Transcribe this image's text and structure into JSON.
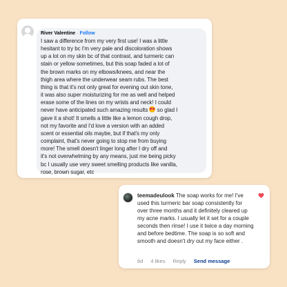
{
  "comment1": {
    "author": "River Valentine",
    "separator": "·",
    "follow_label": "Follow",
    "lines": [
      "I saw a difference from my very first use! I was a little",
      "hesitant to try bc I'm very pale and discoloration shows",
      "up a lot on my skin bc of that contrast, and turmeric can",
      "stain or yellow sometimes, but this soap faded a lot of",
      "the brown marks on my elbows/knees, and near the",
      "thigh area where the underwear seam rubs. The best",
      "thing is that it's not only great for evening out skin tone,",
      "it was also super moisturizing for me as well and helped",
      "erase some of the lines on my wrists and neck! I could",
      "never have anticipated such amazing results"
    ],
    "after_emoji": " so glad I",
    "lines_after": [
      "gave it a shot! It smells a little like a lemon cough drop,",
      "not my favorite and I'd love a version with an added",
      "scent or essential oils maybe, but if that's my only",
      "complaint, that's never going to stop me from buying",
      "more! The smell doesn't linger long after I dry off and",
      "it's not overwhelming by any means, just me being picky",
      "bc I usually use very sweet smelling products like vanilla,",
      "rose, brown sugar, etc"
    ],
    "emoji_icon": "smiling-face-with-heart-eyes-emoji"
  },
  "comment2": {
    "username": "teemadeulook",
    "lines": [
      " The soap works for me! I've",
      "used this turmeric bar soap consistently for",
      "over three months and it definitely cleared up",
      "my acne marks. I usually let it set for a couple",
      "seconds then rinse! I use it twice a day morning",
      "and before bedtime. The soap is so soft and",
      "smooth and doesn't dry out my face either ."
    ],
    "time": "6d",
    "likes": "4 likes",
    "reply_label": "Reply",
    "send_label": "Send message",
    "liked_icon": "heart-filled-icon",
    "colors": {
      "heart": "#ed4956",
      "link": "#0a3d91"
    }
  }
}
